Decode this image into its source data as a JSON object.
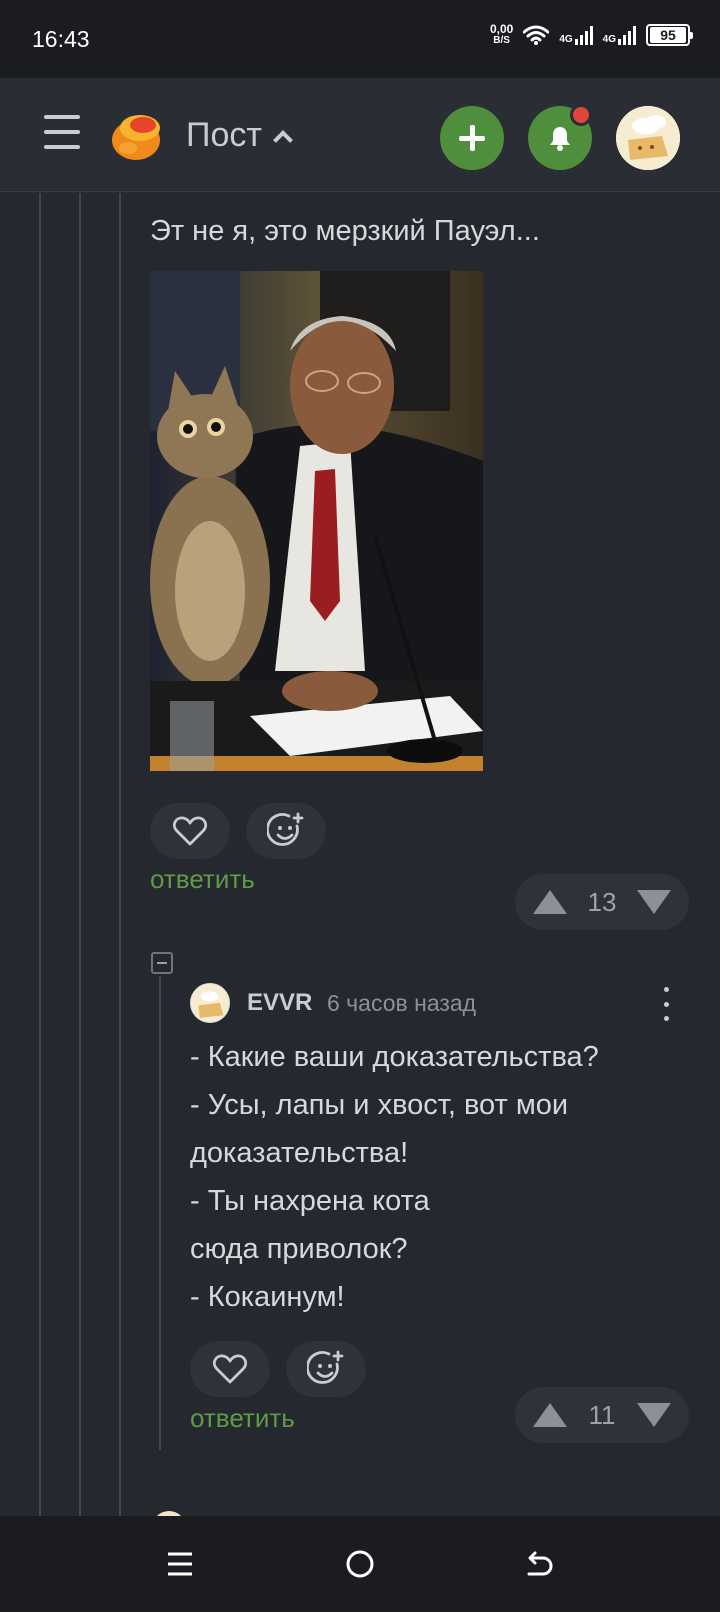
{
  "status_bar": {
    "time": "16:43",
    "net_speed_value": "0,00",
    "net_speed_unit": "B/S",
    "signal_1": "4G",
    "signal_2": "4G",
    "battery": "95"
  },
  "header": {
    "title": "Пост"
  },
  "comment1": {
    "text": "Эт не я, это мерзкий Пауэл...",
    "reply_label": "ответить",
    "rating": "13"
  },
  "comment2": {
    "author": "EVVR",
    "time": "6 часов назад",
    "lines": [
      "- Какие ваши доказательства?",
      "- Усы, лапы и хвост, вот мои",
      "доказательства!",
      "- Ты нахрена кота",
      "сюда приволок?",
      "- Кокаинум!"
    ],
    "reply_label": "ответить",
    "rating": "11"
  },
  "colors": {
    "accent_green": "#4f8e3d",
    "reply_green": "#5f9b46",
    "notification_red": "#e0463a",
    "background": "#25282e"
  },
  "icons": [
    "menu-icon",
    "pikabu-logo",
    "chevron-up-icon",
    "plus-icon",
    "bell-icon",
    "heart-icon",
    "add-emoji-icon",
    "arrow-up-icon",
    "arrow-down-icon",
    "more-vertical-icon",
    "collapse-icon",
    "recent-apps-icon",
    "home-icon",
    "back-icon"
  ]
}
